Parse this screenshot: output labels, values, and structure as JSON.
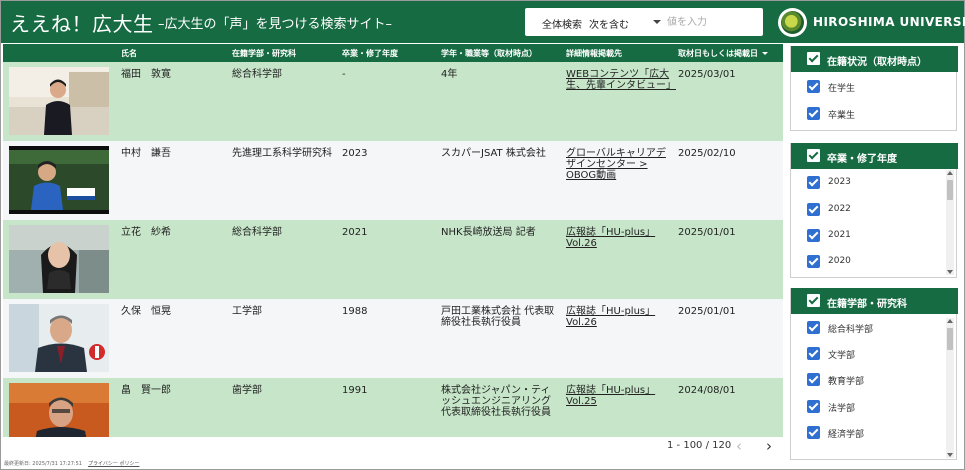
{
  "header": {
    "title": "ええね！広大生",
    "subtitle": "–広大生の「声」を見つける検索サイト–",
    "search_label": "全体検索",
    "search_mode": "次を含む",
    "search_placeholder": "値を入力",
    "university_name": "HIROSHIMA UNIVERSITY"
  },
  "table": {
    "columns": [
      "氏名",
      "在籍学部・研究科",
      "卒業・修了年度",
      "学年・職業等（取材時点）",
      "詳細情報掲載先",
      "取材日もしくは掲載日"
    ],
    "rows": [
      {
        "name": "福田　敦寛",
        "dept": "総合科学部",
        "year": "-",
        "job": "4年",
        "link": "WEBコンテンツ「広大生、先輩インタビュー」",
        "date": "2025/03/01"
      },
      {
        "name": "中村　謙吾",
        "dept": "先進理工系科学研究科",
        "year": "2023",
        "job": "スカパーJSAT 株式会社",
        "link": "グローバルキャリアデザインセンター > OBOG動画",
        "date": "2025/02/10"
      },
      {
        "name": "立花　紗希",
        "dept": "総合科学部",
        "year": "2021",
        "job": "NHK長崎放送局 記者",
        "link": "広報誌「HU-plus」Vol.26",
        "date": "2025/01/01"
      },
      {
        "name": "久保　恒晃",
        "dept": "工学部",
        "year": "1988",
        "job": "戸田工業株式会社 代表取締役社長執行役員",
        "link": "広報誌「HU-plus」Vol.26",
        "date": "2025/01/01"
      },
      {
        "name": "畠　賢一郎",
        "dept": "歯学部",
        "year": "1991",
        "job": "株式会社ジャパン・ティッシュエンジニアリング 代表取締役社長執行役員",
        "link": "広報誌「HU-plus」Vol.25",
        "date": "2024/08/01"
      }
    ]
  },
  "pager": {
    "range_text": "1 - 100 / 120",
    "prev": "‹",
    "next": "›"
  },
  "footer": {
    "updated": "最終更新日: 2025/7/31 17:27:51",
    "privacy": "プライバシー ポリシー"
  },
  "filters": {
    "status": {
      "title": "在籍状況（取材時点）",
      "options": [
        "在学生",
        "卒業生"
      ]
    },
    "grad_year": {
      "title": "卒業・修了年度",
      "options": [
        "2023",
        "2022",
        "2021",
        "2020"
      ]
    },
    "department": {
      "title": "在籍学部・研究科",
      "options": [
        "総合科学部",
        "文学部",
        "教育学部",
        "法学部",
        "経済学部"
      ]
    }
  },
  "colors": {
    "brand_green": "#176b43",
    "row_green": "#c7e6c9",
    "checkbox_blue": "#2f6fd1"
  }
}
